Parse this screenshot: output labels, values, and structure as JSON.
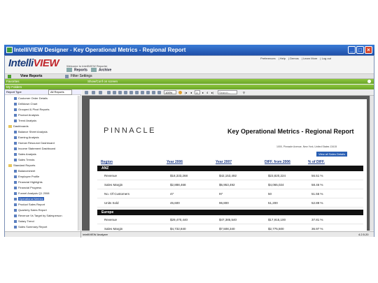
{
  "window": {
    "title": "IntelliVIEW Designer - Key Operational Metrics - Regional Report"
  },
  "header": {
    "logo_main": "Intelli",
    "logo_accent": "VIEW",
    "welcome": "Welcome to IntelliVIEW Reporter",
    "links": [
      "Preferences",
      "Help",
      "Demos",
      "Learn More",
      "Log out"
    ],
    "tabs": {
      "reports": "Reports",
      "archive": "Archive"
    },
    "nav_view_reports": "View Reports",
    "nav_filter_settings": "Filter Settings",
    "favorites": "Favorites",
    "share_label": "Show/Conf on screen",
    "my_folders": "My Folders",
    "report_type_label": "Report Type",
    "report_type_value": "All Reports"
  },
  "tree": [
    {
      "label": "Customer Order Details",
      "kind": "report",
      "indent": 3
    },
    {
      "label": "Drilldown Chart",
      "kind": "report",
      "indent": 3
    },
    {
      "label": "Grouped & Pivot Reports",
      "kind": "report",
      "indent": 3
    },
    {
      "label": "Product Analysis",
      "kind": "report",
      "indent": 3
    },
    {
      "label": "Trend Analysis",
      "kind": "report",
      "indent": 3
    },
    {
      "label": "Dashboards",
      "kind": "folder",
      "indent": 1
    },
    {
      "label": "Balance Sheet Analysis",
      "kind": "report",
      "indent": 3
    },
    {
      "label": "Earning Analysis",
      "kind": "report",
      "indent": 3
    },
    {
      "label": "Human Resource Dashboard",
      "kind": "report",
      "indent": 3
    },
    {
      "label": "Income Statement Dashboard",
      "kind": "report",
      "indent": 3
    },
    {
      "label": "Sales Analysis",
      "kind": "report",
      "indent": 3
    },
    {
      "label": "Sales Trends",
      "kind": "report",
      "indent": 3
    },
    {
      "label": "Standard Reports",
      "kind": "folder",
      "indent": 1
    },
    {
      "label": "Balancesheet",
      "kind": "report",
      "indent": 3
    },
    {
      "label": "Employee Profile",
      "kind": "report",
      "indent": 3
    },
    {
      "label": "Financial Highlights",
      "kind": "report",
      "indent": 3
    },
    {
      "label": "Financial Progress",
      "kind": "report",
      "indent": 3
    },
    {
      "label": "Funnel Analysis Q1 2008",
      "kind": "report",
      "indent": 3
    },
    {
      "label": "Operational Metrics",
      "kind": "report",
      "indent": 3,
      "selected": true
    },
    {
      "label": "Product Sales Report",
      "kind": "report",
      "indent": 3
    },
    {
      "label": "Quarterly Sales Report",
      "kind": "report",
      "indent": 3
    },
    {
      "label": "Revenue Vs Target by Salesperson",
      "kind": "report",
      "indent": 3
    },
    {
      "label": "Salary Trend",
      "kind": "report",
      "indent": 3
    },
    {
      "label": "Sales Summary Report",
      "kind": "report",
      "indent": 3
    }
  ],
  "toolbar": {
    "zoom": "100%",
    "page_current": "1",
    "page_total": "4",
    "search_placeholder": "Search..."
  },
  "report": {
    "brand": "PINNACLE",
    "title": "Key Operational Metrics - Regional Report",
    "address": "1000, Pinnacle Avenue, New York, United States 13415",
    "view_all": "View all Sales Details",
    "columns": [
      "Region",
      "Year 2006",
      "Year 2007",
      "DIFF. from 2006",
      "% of DIFF."
    ],
    "sections": [
      {
        "name": "ANZ",
        "rows": [
          {
            "metric": "Revenue",
            "y2006": "$18,333,268",
            "y2007": "$42,153,492",
            "diff": "$23,820,224",
            "pct": "56.51 %"
          },
          {
            "metric": "Sales Margin",
            "y2006": "$2,888,468",
            "y2007": "$6,953,492",
            "diff": "$4,065,024",
            "pct": "58.46 %"
          },
          {
            "metric": "No. Of Customers",
            "y2006": "47",
            "y2007": "97",
            "diff": "50",
            "pct": "51.55 %"
          },
          {
            "metric": "Units Sold",
            "y2006": "45,600",
            "y2007": "96,800",
            "diff": "51,200",
            "pct": "52.89 %"
          }
        ]
      },
      {
        "name": "Europe",
        "rows": [
          {
            "metric": "Revenue",
            "y2006": "$29,470,440",
            "y2007": "$47,385,540",
            "diff": "$17,915,100",
            "pct": "37.81 %"
          },
          {
            "metric": "Sales Margin",
            "y2006": "$4,732,840",
            "y2007": "$7,508,340",
            "diff": "$2,775,500",
            "pct": "36.97 %"
          }
        ]
      }
    ]
  },
  "statusbar": {
    "left": "IntelliVIEW Analyzer",
    "version": "4.2.5.20"
  },
  "colors": {
    "accent_green": "#7bb534",
    "title_blue": "#1f4fa8",
    "section_black": "#111111"
  }
}
